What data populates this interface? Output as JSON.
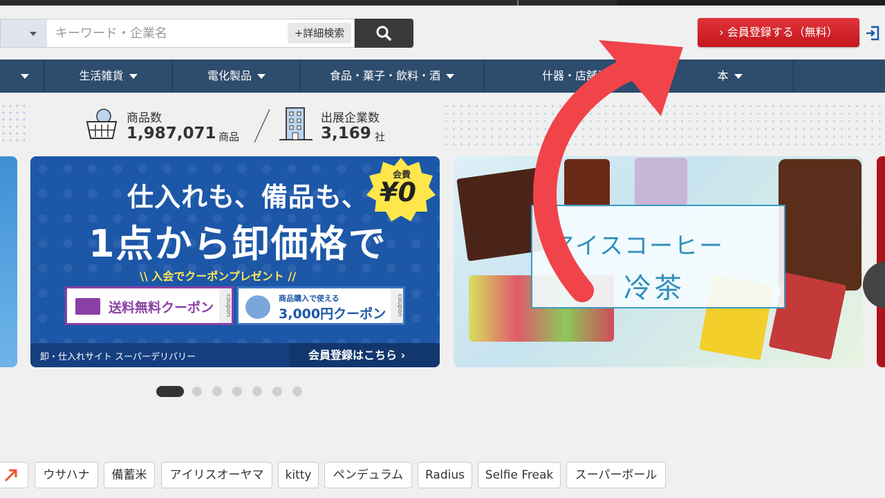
{
  "search": {
    "placeholder": "キーワード・企業名",
    "detail_label": "+詳細検索"
  },
  "header": {
    "register_label": "› 会員登録する（無料）"
  },
  "nav": {
    "items": [
      {
        "label": "生活雑貨"
      },
      {
        "label": "電化製品"
      },
      {
        "label": "食品・菓子・飲料・酒"
      },
      {
        "label": "什器・店舗資"
      },
      {
        "label": "本"
      }
    ]
  },
  "stats": {
    "products_label": "商品数",
    "products_value": "1,987,071",
    "products_unit": "商品",
    "companies_label": "出展企業数",
    "companies_value": "3,169",
    "companies_unit": "社"
  },
  "banner_main": {
    "headline1": "仕入れも、備品も、",
    "headline2": "1点から卸価格で",
    "promo": "\\\\ 入会でクーポンプレゼント //",
    "coupon1": "送料無料クーポン",
    "coupon2_small": "商品購入で使える",
    "coupon2_big": "3,000円クーポン",
    "coupon_side": "coupon",
    "badge_small": "会費",
    "badge_big": "¥0",
    "footer_left": "卸・仕入れサイト スーパーデリバリー",
    "footer_right": "会員登録はこちら ›"
  },
  "banner_right": {
    "title1": "アイスコーヒー",
    "title2": "冷茶"
  },
  "pager": {
    "count": 7,
    "active": 1
  },
  "tags": [
    {
      "label": "ウサハナ"
    },
    {
      "label": "備蓄米"
    },
    {
      "label": "アイリスオーヤマ"
    },
    {
      "label": "kitty"
    },
    {
      "label": "ペンデュラム"
    },
    {
      "label": "Radius"
    },
    {
      "label": "Selfie Freak"
    },
    {
      "label": "スーパーボール"
    }
  ],
  "colors": {
    "nav_bg": "#2e4c6d",
    "register_red": "#c4161c",
    "arrow_red": "#f0444a",
    "banner_blue": "#1d57a8"
  }
}
